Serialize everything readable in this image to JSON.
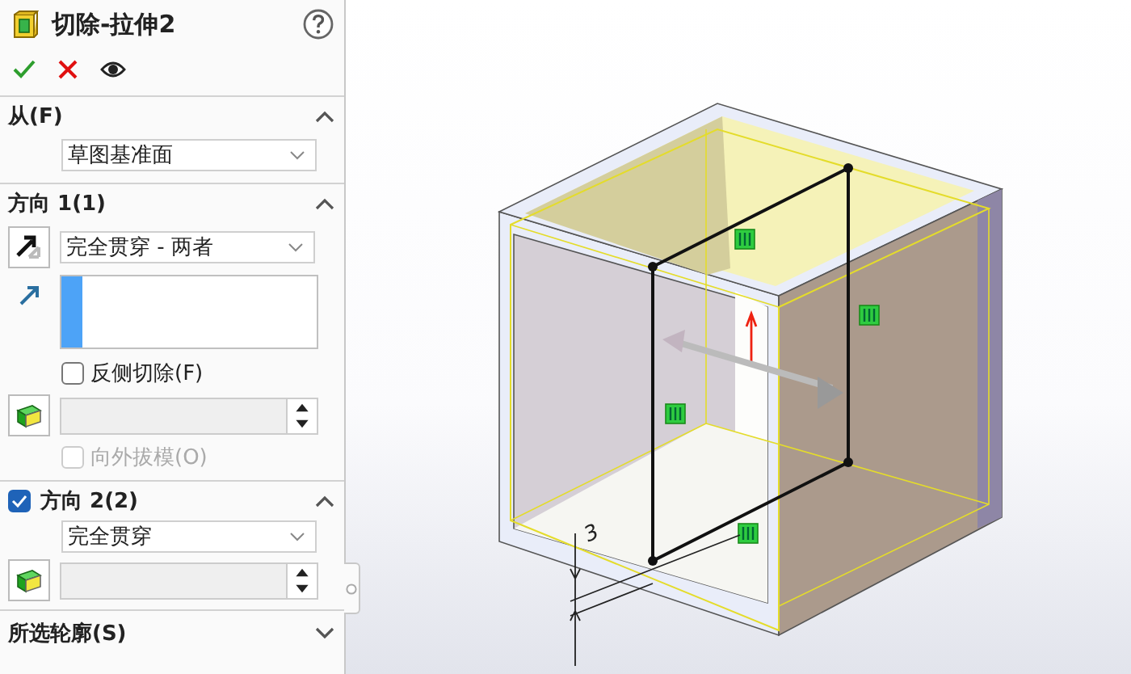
{
  "title": "切除-拉伸2",
  "from": {
    "title": "从(F)",
    "expanded": true,
    "end_condition": "草图基准面"
  },
  "direction1": {
    "title": "方向 1(1)",
    "expanded": true,
    "end_condition": "完全贯穿 - 两者",
    "flip_side": {
      "label": "反侧切除(F)",
      "checked": false
    },
    "draft_angle": {
      "disabled": true
    },
    "draft_outward": {
      "label": "向外拔模(O)",
      "checked": false,
      "disabled": true
    }
  },
  "direction2": {
    "title": "方向 2(2)",
    "checked": true,
    "expanded": true,
    "end_condition": "完全贯穿",
    "depth": {
      "disabled": true
    }
  },
  "selected_contours": {
    "title": "所选轮廓(S)",
    "expanded": false
  },
  "viewport": {
    "dimension": "3"
  }
}
